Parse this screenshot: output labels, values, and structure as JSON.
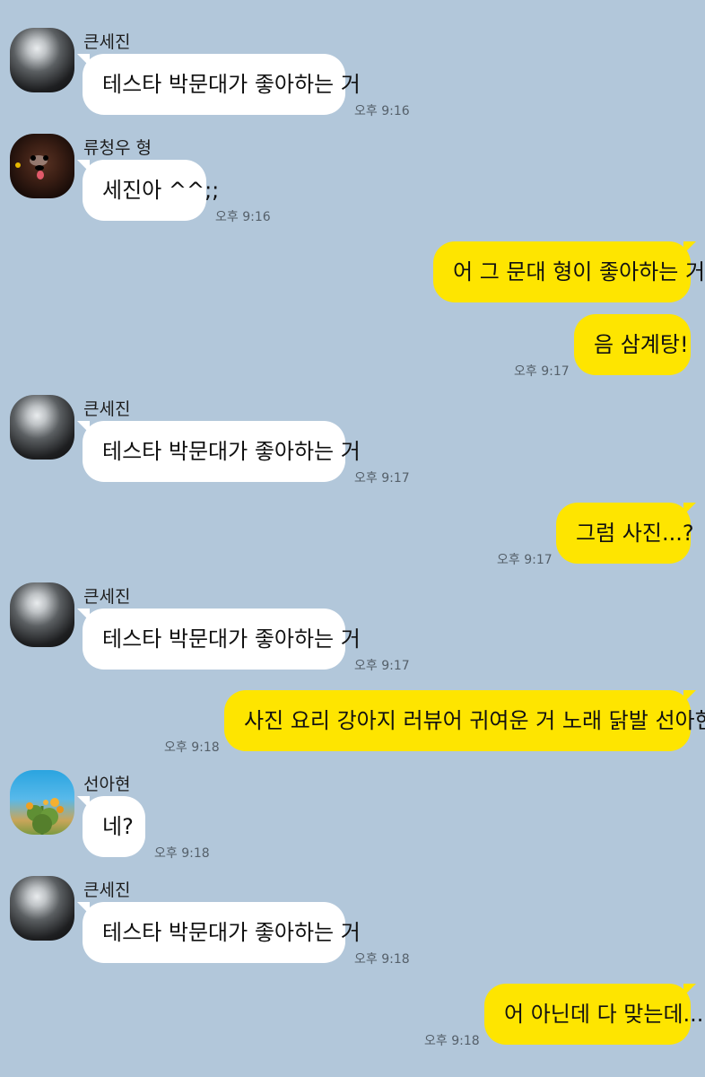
{
  "messages": [
    {
      "type": "in",
      "sender": "큰세진",
      "avatar": "avatar-bw-photo",
      "text": "테스타 박문대가 좋아하는 거",
      "time": "오후 9:16"
    },
    {
      "type": "in",
      "sender": "류청우 형",
      "avatar": "avatar-dog-photo",
      "text": "세진아 ^^;;",
      "time": "오후 9:16"
    },
    {
      "type": "out",
      "text": "어 그 문대 형이 좋아하는 거",
      "time": ""
    },
    {
      "type": "out",
      "text": "음 삼계탕!",
      "time": "오후 9:17"
    },
    {
      "type": "in",
      "sender": "큰세진",
      "avatar": "avatar-bw-photo",
      "text": "테스타 박문대가 좋아하는 거",
      "time": "오후 9:17"
    },
    {
      "type": "out",
      "text": "그럼 사진...?",
      "time": "오후 9:17"
    },
    {
      "type": "in",
      "sender": "큰세진",
      "avatar": "avatar-bw-photo",
      "text": "테스타 박문대가 좋아하는 거",
      "time": "오후 9:17"
    },
    {
      "type": "out",
      "text": "사진 요리 강아지 러뷰어 귀여운 거 노래 닭발 선아현님",
      "time": "오후 9:18"
    },
    {
      "type": "in",
      "sender": "선아현",
      "avatar": "avatar-flower-photo",
      "text": "네?",
      "time": "오후 9:18"
    },
    {
      "type": "in",
      "sender": "큰세진",
      "avatar": "avatar-bw-photo",
      "text": "테스타 박문대가 좋아하는 거",
      "time": "오후 9:18"
    },
    {
      "type": "out",
      "text": "어 아닌데 다 맞는데...",
      "time": "오후 9:18"
    }
  ],
  "colors": {
    "background": "#b2c7da",
    "incoming_bubble": "#ffffff",
    "outgoing_bubble": "#fee500"
  }
}
